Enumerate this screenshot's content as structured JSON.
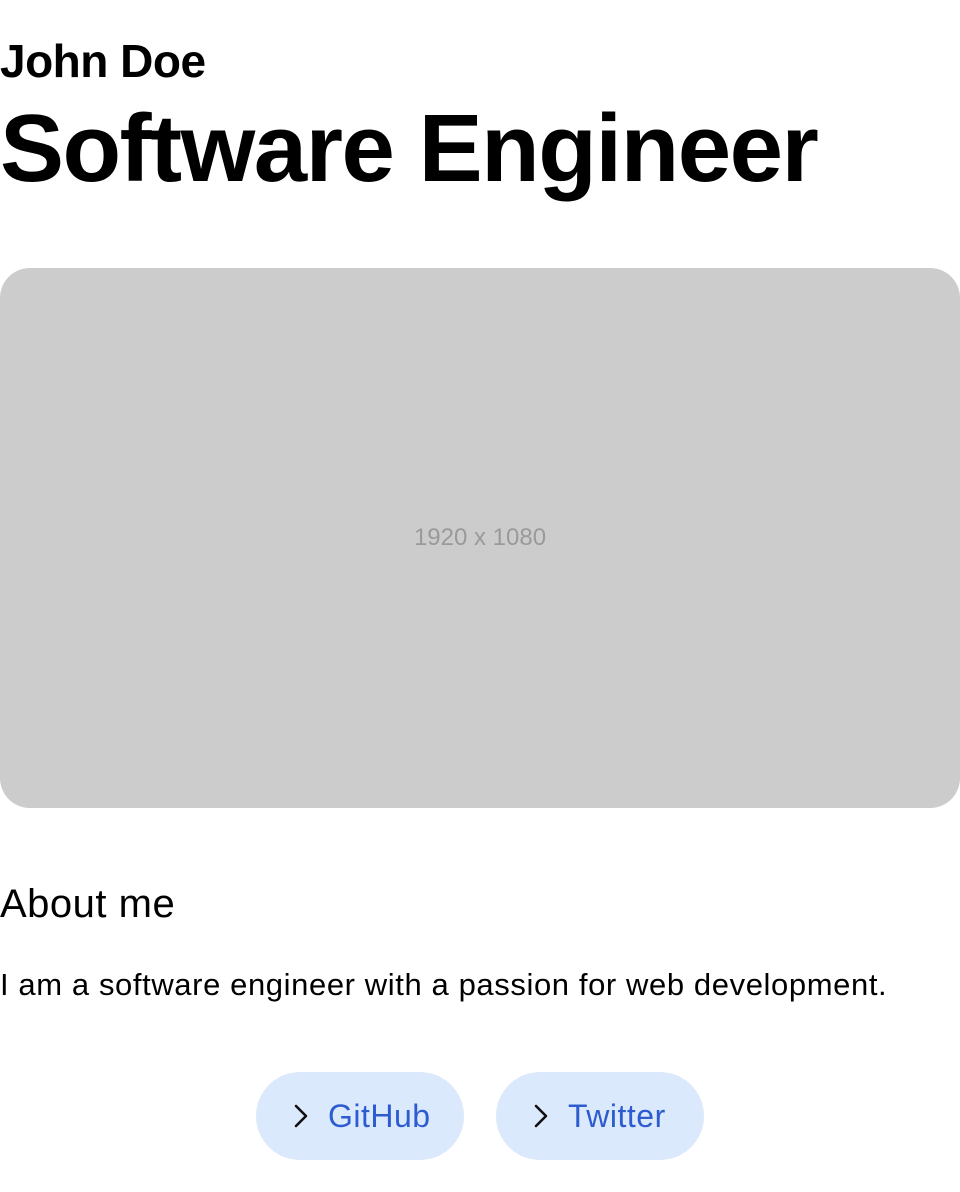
{
  "header": {
    "name": "John Doe",
    "role": "Software Engineer"
  },
  "hero": {
    "placeholder_label": "1920 x 1080",
    "background_color": "#cccccc"
  },
  "about": {
    "heading": "About me",
    "text": "I am a software engineer with a passion for web development."
  },
  "links": [
    {
      "label": "GitHub",
      "icon": "chevron-right-icon"
    },
    {
      "label": "Twitter",
      "icon": "chevron-right-icon"
    }
  ],
  "colors": {
    "link_background": "#dbe9fd",
    "link_text": "#2d5bd0"
  }
}
